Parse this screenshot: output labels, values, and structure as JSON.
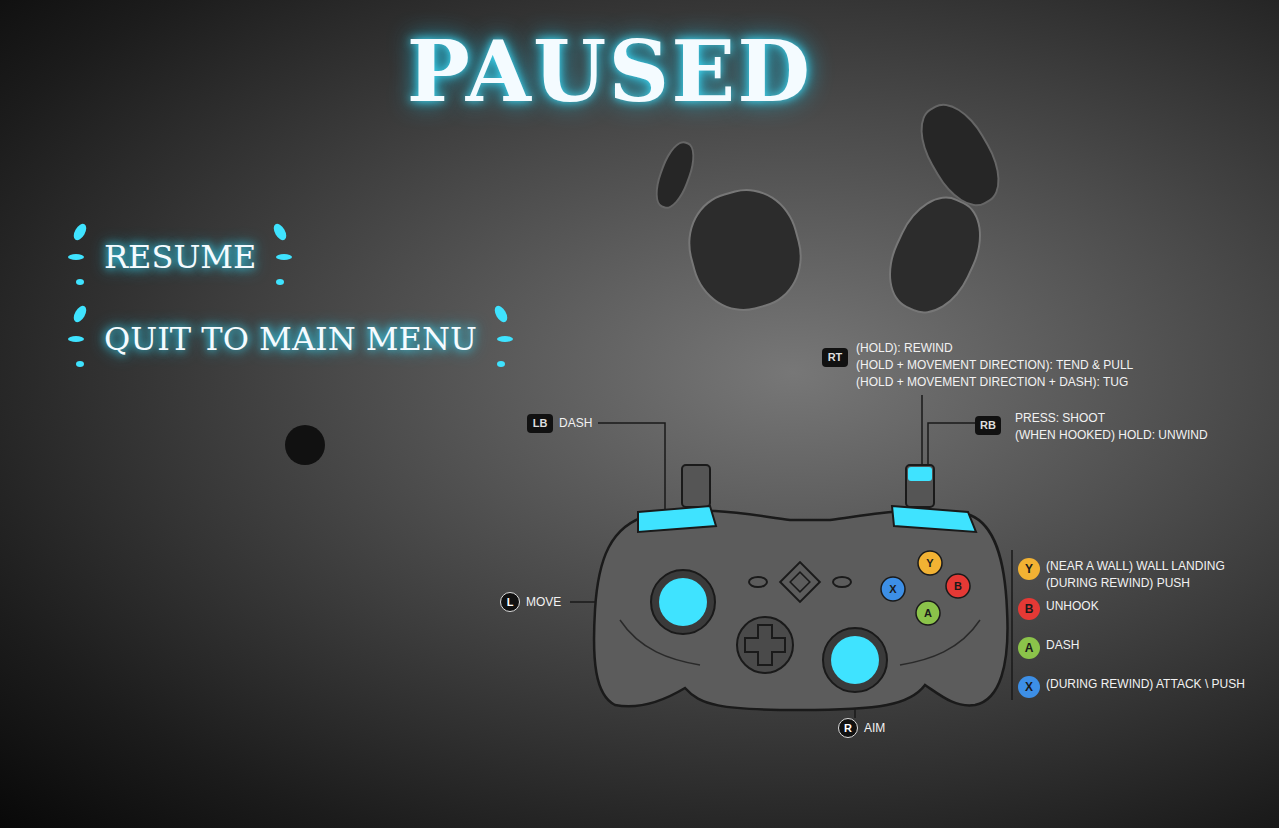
{
  "title": "PAUSED",
  "menu": [
    {
      "label": "RESUME"
    },
    {
      "label": "QUIT TO MAIN MENU"
    }
  ],
  "controls": {
    "lb": {
      "key": "LB",
      "lines": [
        "DASH"
      ]
    },
    "rt": {
      "key": "RT",
      "lines": [
        "(HOLD): REWIND",
        "(HOLD + MOVEMENT DIRECTION): TEND & PULL",
        "(HOLD + MOVEMENT DIRECTION + DASH): TUG"
      ]
    },
    "rb": {
      "key": "RB",
      "lines": [
        "PRESS: SHOOT",
        "(WHEN HOOKED) HOLD: UNWIND"
      ]
    },
    "left_stick": {
      "key": "L",
      "lines": [
        "MOVE"
      ]
    },
    "right_stick": {
      "key": "R",
      "lines": [
        "AIM"
      ]
    }
  },
  "face_buttons": [
    {
      "key": "Y",
      "color": "#f2b233",
      "lines": [
        "(NEAR A WALL) WALL LANDING",
        "(DURING REWIND) PUSH"
      ]
    },
    {
      "key": "B",
      "color": "#e53935",
      "lines": [
        "UNHOOK"
      ]
    },
    {
      "key": "A",
      "color": "#8bc34a",
      "lines": [
        "DASH"
      ]
    },
    {
      "key": "X",
      "color": "#3d8fe6",
      "lines": [
        "(DURING REWIND) ATTACK \\ PUSH"
      ]
    }
  ]
}
